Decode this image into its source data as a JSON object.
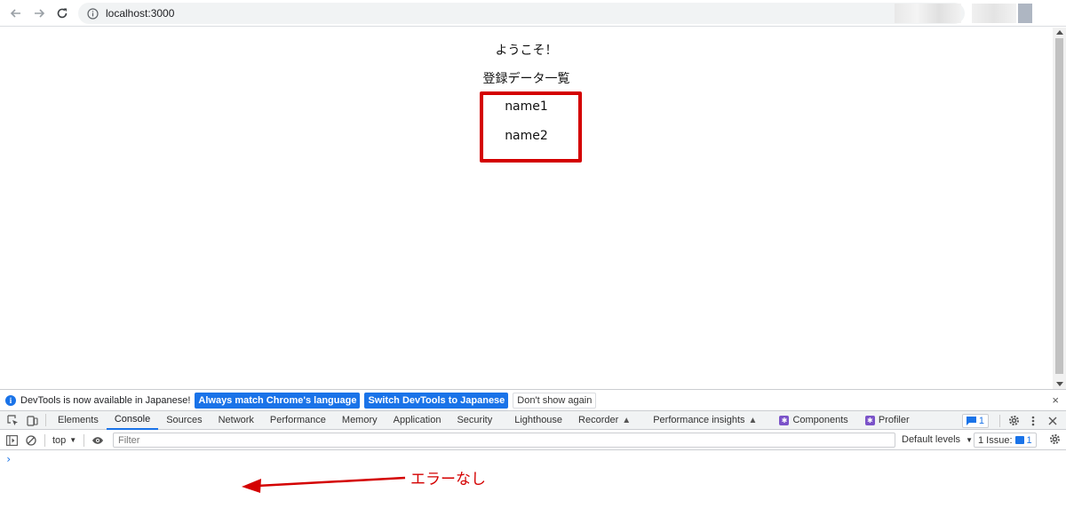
{
  "browser": {
    "url": "localhost:3000"
  },
  "page": {
    "welcome": "ようこそ！",
    "list_title": "登録データ一覧",
    "items": [
      "name1",
      "name2"
    ]
  },
  "infobar": {
    "message": "DevTools is now available in Japanese!",
    "btn_match": "Always match Chrome's language",
    "btn_switch": "Switch DevTools to Japanese",
    "btn_dont_show": "Don't show again",
    "close": "×"
  },
  "devtools": {
    "tabs": [
      "Elements",
      "Console",
      "Sources",
      "Network",
      "Performance",
      "Memory",
      "Application",
      "Security",
      "Lighthouse",
      "Recorder",
      "Performance insights",
      "Components",
      "Profiler"
    ],
    "message_count": "1"
  },
  "console": {
    "context": "top",
    "filter_placeholder": "Filter",
    "levels": "Default levels",
    "issues_label": "1 Issue:",
    "issues_count": "1",
    "prompt": "›"
  },
  "annotation": {
    "text": "エラーなし",
    "color": "#d40000"
  },
  "colors": {
    "accent": "#1a73e8",
    "highlight": "#d40000"
  }
}
